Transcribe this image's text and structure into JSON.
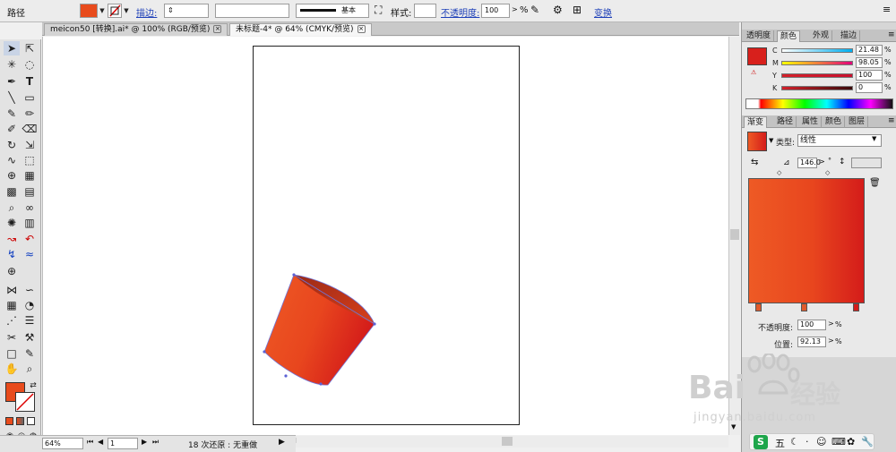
{
  "control_bar": {
    "object_type": "路径",
    "stroke_label": "描边:",
    "stroke_profile": "基本",
    "style_label": "样式:",
    "opacity_label": "不透明度:",
    "opacity_value": "100",
    "opacity_unit": "%",
    "transform_label": "变换",
    "fill_color": "#e84b1c"
  },
  "doc_tabs": [
    {
      "label": "meicon50 [转换].ai* @ 100% (RGB/预览)",
      "active": false
    },
    {
      "label": "未标题-4* @ 64% (CMYK/预览)",
      "active": true
    }
  ],
  "status": {
    "zoom": "64%",
    "page": "1",
    "history": "18 次还原 : 无重做"
  },
  "color_panel": {
    "tabs": [
      "透明度",
      "颜色",
      "外观",
      "描边"
    ],
    "active_tab": "颜色",
    "swatch": "#d8201c",
    "channels": [
      {
        "name": "C",
        "value": "21.48",
        "level": 0.2148
      },
      {
        "name": "M",
        "value": "98.05",
        "level": 0.9805
      },
      {
        "name": "Y",
        "value": "100",
        "level": 1.0
      },
      {
        "name": "K",
        "value": "0",
        "level": 0.0
      }
    ]
  },
  "gradient_panel": {
    "tabs": [
      "渐变",
      "路径",
      "属性",
      "颜色",
      "图层"
    ],
    "active_tab": "渐变",
    "type_label": "类型:",
    "type_value": "线性",
    "angle_value": "146.0",
    "opacity_label": "不透明度:",
    "opacity_value": "100",
    "position_label": "位置:",
    "position_value": "92.13",
    "unit": "%",
    "colors": [
      "#ee5a25",
      "#e8461e",
      "#d41c1a"
    ]
  },
  "watermark": {
    "brand": "Bai",
    "brand_cn": "经验",
    "url": "jingyan.baidu.com"
  },
  "ime": {
    "label": "五"
  }
}
